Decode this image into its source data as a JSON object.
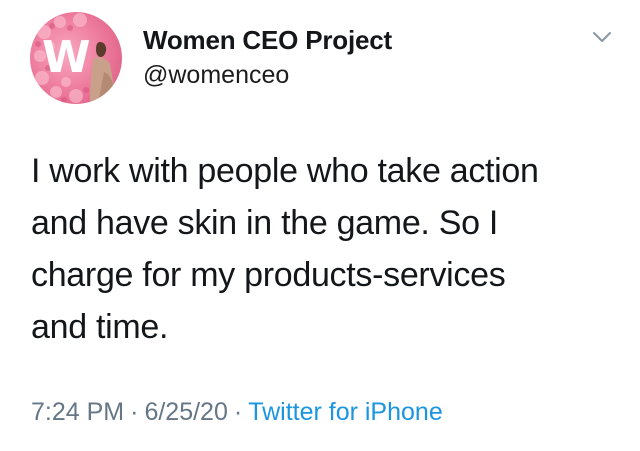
{
  "tweet": {
    "author": {
      "display_name": "Women CEO Project",
      "handle": "@womenceo",
      "avatar_letter": "W",
      "avatar_colors": {
        "background": "#ef7fa0",
        "letter": "#ffffff"
      }
    },
    "text_lines": [
      "I work with people who take action",
      "and have skin in the game. So I",
      "charge for my products-services",
      "and time."
    ],
    "time": "7:24 PM",
    "date": "6/25/20",
    "separator": "·",
    "source": "Twitter for iPhone",
    "menu_icon": "chevron-down-icon"
  },
  "colors": {
    "text": "#14171a",
    "meta": "#657786",
    "link": "#1b95e0",
    "chevron": "#8899a6"
  }
}
